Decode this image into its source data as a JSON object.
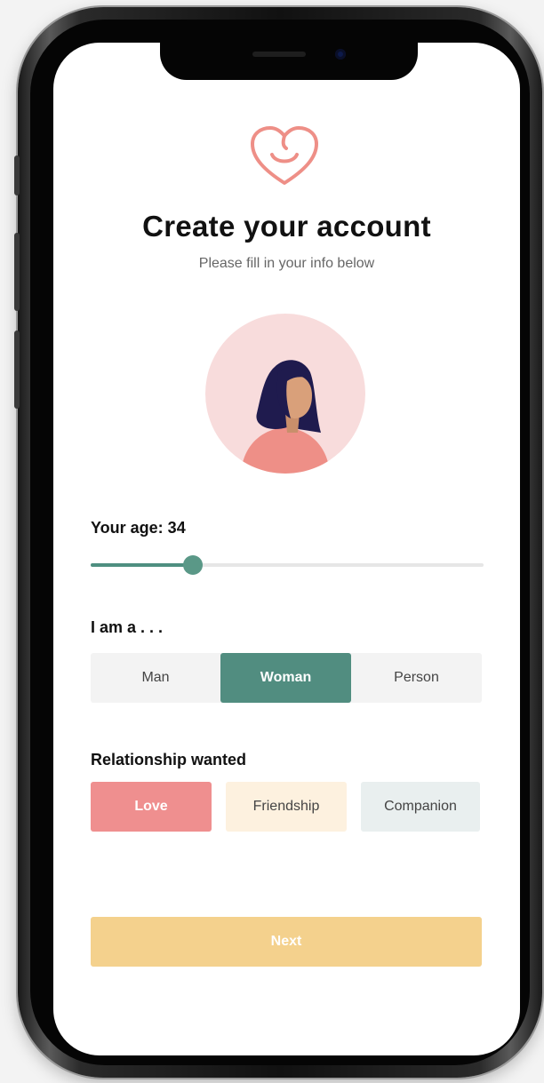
{
  "header": {
    "logo_icon": "heart-smile-icon",
    "title": "Create your account",
    "subtitle": "Please fill in your info below"
  },
  "avatar": {
    "icon": "woman-avatar-icon",
    "colors": {
      "background": "#f8dcdc",
      "hair": "#1f1b4e",
      "skin": "#d9a07a",
      "shirt": "#ee8f87"
    }
  },
  "age": {
    "label": "Your age: 34",
    "value": 34,
    "slider_fraction": 0.26
  },
  "gender": {
    "label": "I am a . . .",
    "options": [
      "Man",
      "Woman",
      "Person"
    ],
    "selected": "Woman"
  },
  "relationship": {
    "label": "Relationship wanted",
    "options": [
      "Love",
      "Friendship",
      "Companion"
    ],
    "selected": "Love"
  },
  "actions": {
    "next_label": "Next"
  },
  "colors": {
    "accent_green": "#518d80",
    "love_pink": "#ef8f8f",
    "friendship_cream": "#fdf1df",
    "companion_grey": "#e9efef",
    "next_yellow": "#f4d18d",
    "logo_pink": "#ee8f87"
  }
}
